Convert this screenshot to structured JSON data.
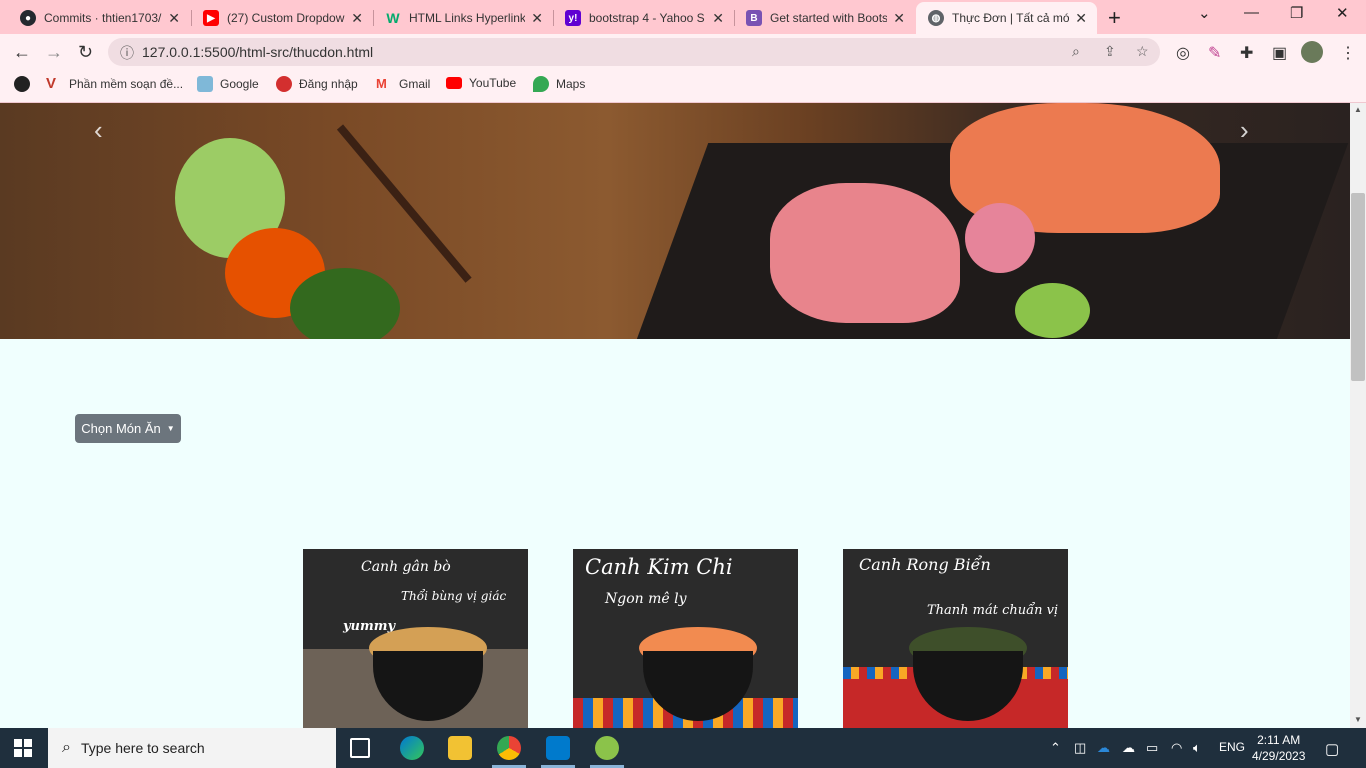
{
  "browser": {
    "tabs": [
      {
        "label": "Commits · thtien1703/",
        "icon": "github-icon",
        "color": "#24292f"
      },
      {
        "label": "(27) Custom Dropdow",
        "icon": "youtube-icon",
        "color": "#ff0000"
      },
      {
        "label": "HTML Links Hyperlinks",
        "icon": "w3schools-icon",
        "color": "#04aa6d"
      },
      {
        "label": "bootstrap 4 - Yahoo S",
        "icon": "yahoo-icon",
        "color": "#6001d2"
      },
      {
        "label": "Get started with Boots",
        "icon": "bootstrap-icon",
        "color": "#7952b3"
      },
      {
        "label": "Thực Đơn | Tất cả món",
        "icon": "globe-icon",
        "color": "#5f6368"
      }
    ],
    "url": "127.0.0.1:5500/html-src/thucdon.html",
    "bookmarks": [
      {
        "label": "",
        "icon": "globe-icon"
      },
      {
        "label": "Phần mềm soạn đề...",
        "icon": "v-logo-icon"
      },
      {
        "label": "Google",
        "icon": "google-icon"
      },
      {
        "label": "Đăng nhập",
        "icon": "login-icon"
      },
      {
        "label": "Gmail",
        "icon": "gmail-icon"
      },
      {
        "label": "YouTube",
        "icon": "youtube-icon"
      },
      {
        "label": "Maps",
        "icon": "maps-icon"
      }
    ]
  },
  "page": {
    "dropdown_label": "Chọn Món Ăn",
    "cards": [
      {
        "title": "Canh gân bò",
        "line2": "Thổi bùng vị giác",
        "line3": "yummy"
      },
      {
        "title": "Canh Kim Chi",
        "line2": "Ngon mê ly",
        "line3": ""
      },
      {
        "title": "Canh Rong Biển",
        "line2": "Thanh mát chuẩn vị",
        "line3": ""
      }
    ]
  },
  "taskbar": {
    "search_placeholder": "Type here to search",
    "language": "ENG",
    "time": "2:11 AM",
    "date": "4/29/2023"
  }
}
